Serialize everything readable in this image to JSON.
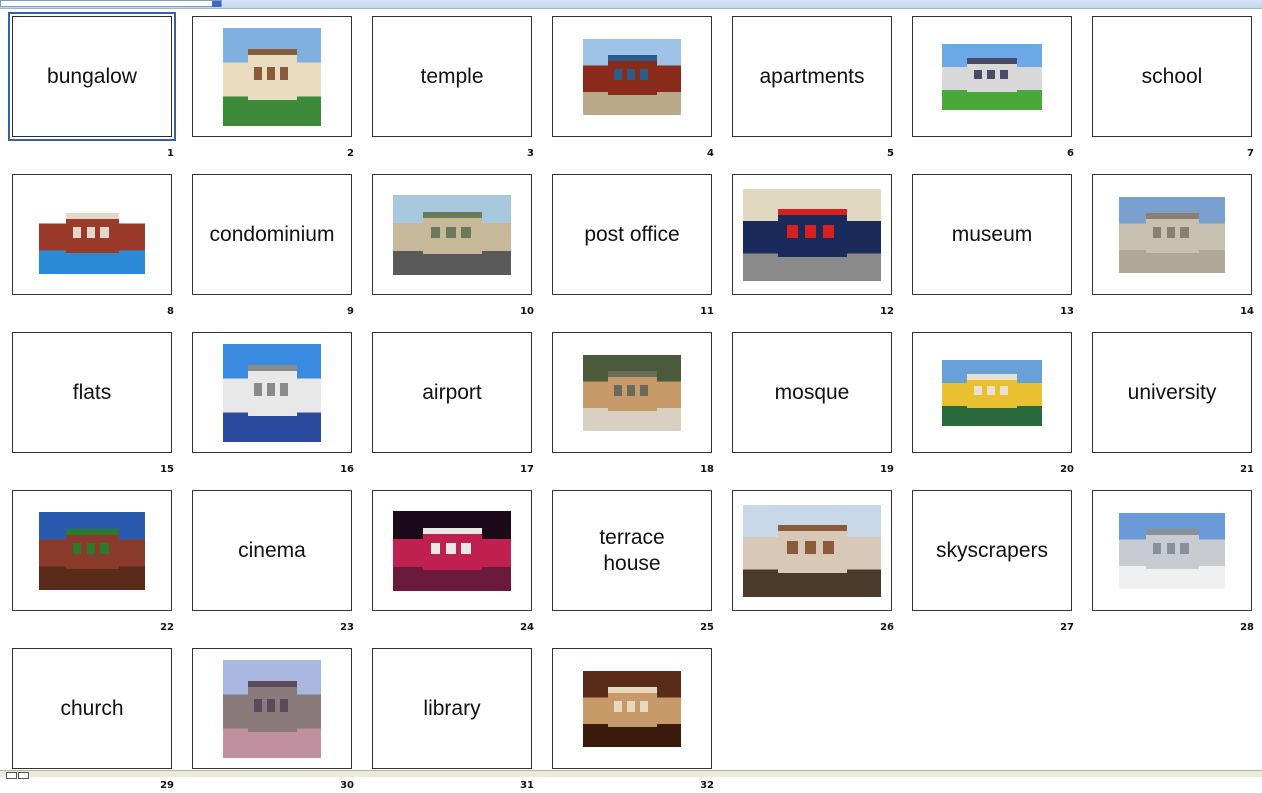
{
  "slides": [
    {
      "number": "1",
      "type": "text",
      "label": "bungalow",
      "selected": true
    },
    {
      "number": "2",
      "type": "photo",
      "icon": "bungalow-photo",
      "colors": [
        "#7fb0e0",
        "#e9dcc0",
        "#8a5a3a",
        "#3d8a3a"
      ]
    },
    {
      "number": "3",
      "type": "text",
      "label": "temple"
    },
    {
      "number": "4",
      "type": "photo",
      "icon": "temple-photo",
      "colors": [
        "#9fc3e8",
        "#8a2a1a",
        "#2c5d8a",
        "#b9a88a"
      ]
    },
    {
      "number": "5",
      "type": "text",
      "label": "apartments"
    },
    {
      "number": "6",
      "type": "photo",
      "icon": "apartments-photo",
      "colors": [
        "#6aa8e8",
        "#d8d8d8",
        "#4a4a6a",
        "#4aa83a"
      ]
    },
    {
      "number": "7",
      "type": "text",
      "label": "school"
    },
    {
      "number": "8",
      "type": "photo",
      "icon": "school-photo",
      "colors": [
        "#ffffff",
        "#9a3a2a",
        "#e0d8c8",
        "#2a8ad8"
      ]
    },
    {
      "number": "9",
      "type": "text",
      "label": "condominium"
    },
    {
      "number": "10",
      "type": "photo",
      "icon": "condominium-photo",
      "colors": [
        "#a8c8e0",
        "#c8b89a",
        "#6a7a5a",
        "#5a5a5a"
      ]
    },
    {
      "number": "11",
      "type": "text",
      "label": "post office"
    },
    {
      "number": "12",
      "type": "photo",
      "icon": "post-office-photo",
      "colors": [
        "#e0d8c0",
        "#1a2a5a",
        "#d82020",
        "#8a8a8a"
      ]
    },
    {
      "number": "13",
      "type": "text",
      "label": "museum"
    },
    {
      "number": "14",
      "type": "photo",
      "icon": "museum-photo",
      "colors": [
        "#7aa0d0",
        "#c8c0b0",
        "#8a8070",
        "#b0a898"
      ]
    },
    {
      "number": "15",
      "type": "text",
      "label": "flats"
    },
    {
      "number": "16",
      "type": "photo",
      "icon": "flats-photo",
      "colors": [
        "#3a8ae0",
        "#e8e8e8",
        "#8a8a8a",
        "#2a4aa0"
      ]
    },
    {
      "number": "17",
      "type": "text",
      "label": "airport"
    },
    {
      "number": "18",
      "type": "photo",
      "icon": "airport-photo",
      "colors": [
        "#4a5a3a",
        "#c89a6a",
        "#6a6a5a",
        "#d8d0c0"
      ]
    },
    {
      "number": "19",
      "type": "text",
      "label": "mosque"
    },
    {
      "number": "20",
      "type": "photo",
      "icon": "mosque-photo",
      "colors": [
        "#6aa0d8",
        "#e8c030",
        "#e8e0d0",
        "#2a6a3a"
      ]
    },
    {
      "number": "21",
      "type": "text",
      "label": "university"
    },
    {
      "number": "22",
      "type": "photo",
      "icon": "university-photo",
      "colors": [
        "#2a5ab0",
        "#8a3a2a",
        "#2a7a2a",
        "#5a2a1a"
      ]
    },
    {
      "number": "23",
      "type": "text",
      "label": "cinema"
    },
    {
      "number": "24",
      "type": "photo",
      "icon": "cinema-photo",
      "colors": [
        "#1a0a1a",
        "#c02050",
        "#e8e8e8",
        "#6a1a3a"
      ]
    },
    {
      "number": "25",
      "type": "text",
      "label": "terrace\nhouse"
    },
    {
      "number": "26",
      "type": "photo",
      "icon": "terrace-house-photo",
      "colors": [
        "#c8d8e8",
        "#d8c8b8",
        "#8a5a3a",
        "#4a3a2a"
      ]
    },
    {
      "number": "27",
      "type": "text",
      "label": "skyscrapers"
    },
    {
      "number": "28",
      "type": "photo",
      "icon": "skyscrapers-photo",
      "colors": [
        "#6a9ad8",
        "#c8ccd0",
        "#8a9098",
        "#f0f0f0"
      ]
    },
    {
      "number": "29",
      "type": "text",
      "label": "church"
    },
    {
      "number": "30",
      "type": "photo",
      "icon": "church-photo",
      "colors": [
        "#a8b8e0",
        "#8a7a7a",
        "#5a4a5a",
        "#c090a0"
      ]
    },
    {
      "number": "31",
      "type": "text",
      "label": "library"
    },
    {
      "number": "32",
      "type": "photo",
      "icon": "library-photo",
      "colors": [
        "#5a2a1a",
        "#c89a6a",
        "#e8d8c0",
        "#3a1a0a"
      ]
    }
  ]
}
